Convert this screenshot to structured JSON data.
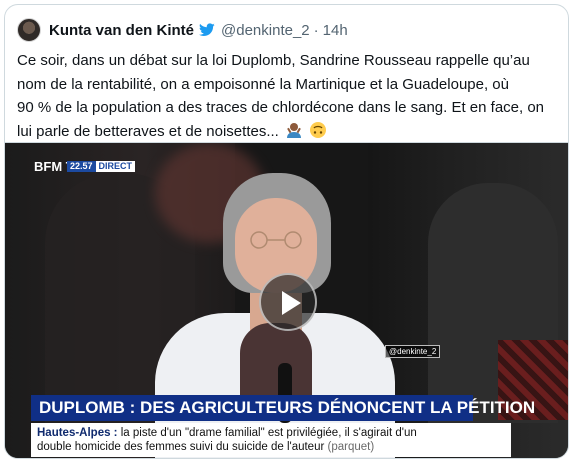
{
  "tweet": {
    "author_name": "Kunta van den Kinté",
    "handle": "@denkinte_2",
    "separator": "·",
    "time": "14h",
    "text_lines": [
      "Ce soir, dans un débat sur la loi Duplomb, Sandrine Rousseau rappelle qu’au",
      "nom de la rentabilité, on a empoisonné la Martinique et la Guadeloupe, où",
      "90 % de la population a des traces de chlordécone dans le sang. Et en face, on",
      "lui parle de betteraves et de noisettes..."
    ],
    "emojis": [
      "person-shrugging-emoji",
      "upside-down-face-emoji"
    ]
  },
  "video": {
    "channel_logo": "BFM TV.",
    "live_time": "22.57",
    "live_label": "DIRECT",
    "watermark": "@denkinte_2",
    "headline": "DUPLOMB : DES AGRICULTEURS DÉNONCENT LA PÉTITION",
    "ticker_place": "Hautes-Alpes :",
    "ticker_line1": "la piste d'un \"drame familial\" est privilégiée, il s'agirait d'un",
    "ticker_line2": "double homicide des femmes suivi du suicide de l'auteur",
    "ticker_source": "(parquet)"
  },
  "colors": {
    "name": "#0f1419",
    "muted": "#536471",
    "bird": "#1d9bf0",
    "banner": "#102f86"
  }
}
